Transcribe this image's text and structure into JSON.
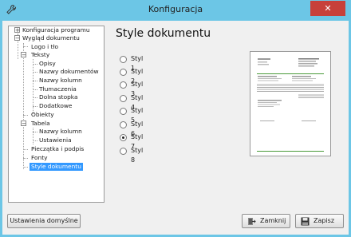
{
  "window": {
    "title": "Konfiguracja",
    "close_icon": "close-icon",
    "app_icon": "wrench-icon"
  },
  "tree": {
    "items": [
      {
        "label": "Konfiguracja programu",
        "expander": "+"
      },
      {
        "label": "Wygląd dokumentu",
        "expander": "−"
      },
      {
        "label": "Logo i tło"
      },
      {
        "label": "Teksty",
        "expander": "−"
      },
      {
        "label": "Opisy"
      },
      {
        "label": "Nazwy dokumentów"
      },
      {
        "label": "Nazwy kolumn"
      },
      {
        "label": "Tłumaczenia"
      },
      {
        "label": "Dolna stopka"
      },
      {
        "label": "Dodatkowe"
      },
      {
        "label": "Obiekty"
      },
      {
        "label": "Tabela",
        "expander": "−"
      },
      {
        "label": "Nazwy kolumn"
      },
      {
        "label": "Ustawienia"
      },
      {
        "label": "Pieczątka i podpis"
      },
      {
        "label": "Fonty"
      },
      {
        "label": "Style dokumentu",
        "selected": true
      }
    ]
  },
  "main": {
    "heading": "Style dokumentu",
    "styles": [
      {
        "label": "Styl 1",
        "checked": false
      },
      {
        "label": "Styl 2",
        "checked": false
      },
      {
        "label": "Styl 3",
        "checked": false
      },
      {
        "label": "Styl 4",
        "checked": false
      },
      {
        "label": "Styl 5",
        "checked": false
      },
      {
        "label": "Styl 6",
        "checked": false
      },
      {
        "label": "Styl 7",
        "checked": true
      },
      {
        "label": "Styl 8",
        "checked": false
      }
    ]
  },
  "footer": {
    "defaults_label": "Ustawienia domyślne",
    "close_label": "Zamknij",
    "save_label": "Zapisz",
    "close_icon": "door-exit-icon",
    "save_icon": "floppy-disk-icon"
  },
  "colors": {
    "frame": "#6cc6e6",
    "close": "#c7403a",
    "selection": "#3399ff",
    "preview_accent": "#4a9a3a"
  }
}
